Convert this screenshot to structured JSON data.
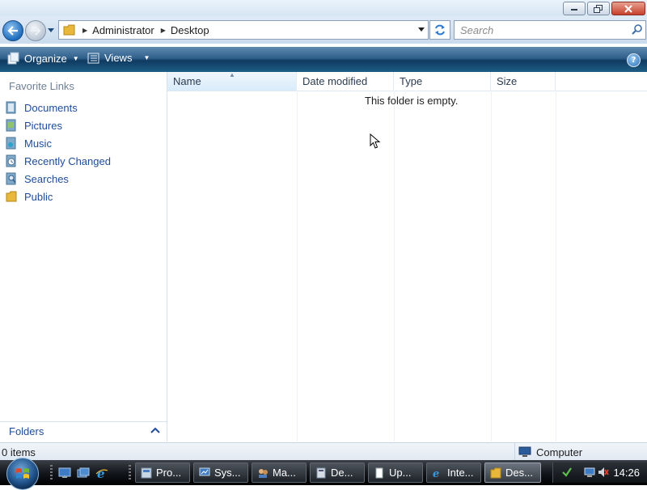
{
  "window": {
    "controls": {
      "minimize": "minimize",
      "maximize": "restore",
      "close": "close"
    }
  },
  "address_bar": {
    "breadcrumbs": [
      "Administrator",
      "Desktop"
    ],
    "search_placeholder": "Search"
  },
  "toolbar": {
    "organize_label": "Organize",
    "views_label": "Views",
    "help_label": "?"
  },
  "nav_pane": {
    "header": "Favorite Links",
    "items": [
      {
        "label": "Documents",
        "icon": "documents-icon"
      },
      {
        "label": "Pictures",
        "icon": "pictures-icon"
      },
      {
        "label": "Music",
        "icon": "music-icon"
      },
      {
        "label": "Recently Changed",
        "icon": "recently-changed-icon"
      },
      {
        "label": "Searches",
        "icon": "searches-icon"
      },
      {
        "label": "Public",
        "icon": "public-folder-icon"
      }
    ],
    "folders_label": "Folders"
  },
  "file_list": {
    "columns": [
      "Name",
      "Date modified",
      "Type",
      "Size"
    ],
    "sorted_column": "Name",
    "empty_message": "This folder is empty."
  },
  "status_bar": {
    "item_count": "0 items",
    "zone": "Computer"
  },
  "taskbar": {
    "tasks": [
      {
        "label": "Pro...",
        "icon": "program-icon",
        "active": false
      },
      {
        "label": "Sys...",
        "icon": "system-icon",
        "active": false
      },
      {
        "label": "Ma...",
        "icon": "users-icon",
        "active": false
      },
      {
        "label": "De...",
        "icon": "device-icon",
        "active": false
      },
      {
        "label": "Up...",
        "icon": "update-icon",
        "active": false
      },
      {
        "label": "Inte...",
        "icon": "ie-icon",
        "active": false
      },
      {
        "label": "Des...",
        "icon": "folder-icon",
        "active": true
      }
    ],
    "clock": "14:26"
  },
  "colors": {
    "link_blue": "#1e4c98",
    "toolbar_dark": "#0f3a61",
    "taskbar_black": "#000000"
  }
}
